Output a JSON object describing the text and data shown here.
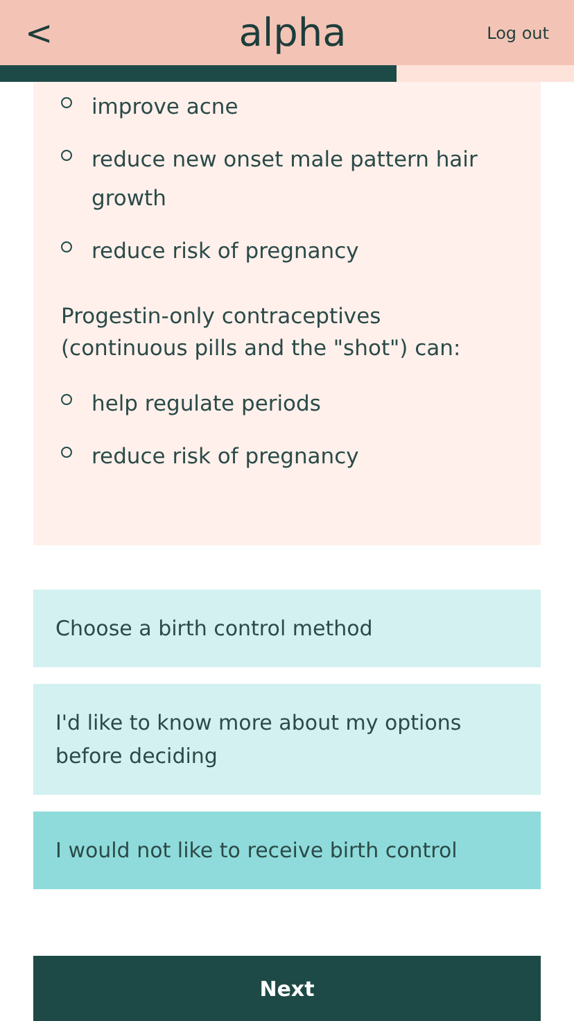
{
  "header": {
    "back": "<",
    "logo": "alpha",
    "logout": "Log out"
  },
  "progress": {
    "level": 0.69
  },
  "info_card": {
    "list_1": [
      "improve acne",
      "reduce new onset male pattern hair growth",
      "reduce risk of pregnancy"
    ],
    "paragraph": "Progestin-only contraceptives (continuous pills and the \"shot\") can:",
    "list_2": [
      "help regulate periods",
      "reduce risk of pregnancy"
    ]
  },
  "options": [
    {
      "label": "Choose a birth control method",
      "selected": false
    },
    {
      "label": "I'd like to know more about my options before deciding",
      "selected": false
    },
    {
      "label": "I would not like to receive birth control",
      "selected": true
    }
  ],
  "next_button": "Next"
}
